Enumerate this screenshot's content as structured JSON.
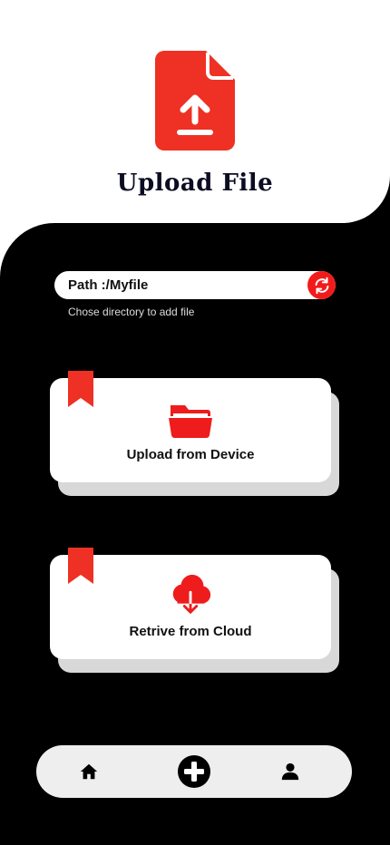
{
  "header": {
    "title": "Upload File",
    "icon": "file-upload-icon",
    "accent": "#ee3124"
  },
  "path": {
    "value": "Path :/Myfile",
    "hint": "Chose directory to add file",
    "refresh_icon": "refresh-icon",
    "refresh_color": "#f21b1b"
  },
  "cards": [
    {
      "label": "Upload from Device",
      "icon": "folder-icon",
      "bookmark_icon": "bookmark-icon"
    },
    {
      "label": "Retrive from Cloud",
      "icon": "cloud-download-icon",
      "bookmark_icon": "bookmark-icon"
    }
  ],
  "bottom_nav": {
    "items": [
      {
        "icon": "home-icon"
      },
      {
        "icon": "add-circle-icon"
      },
      {
        "icon": "user-icon"
      }
    ]
  }
}
